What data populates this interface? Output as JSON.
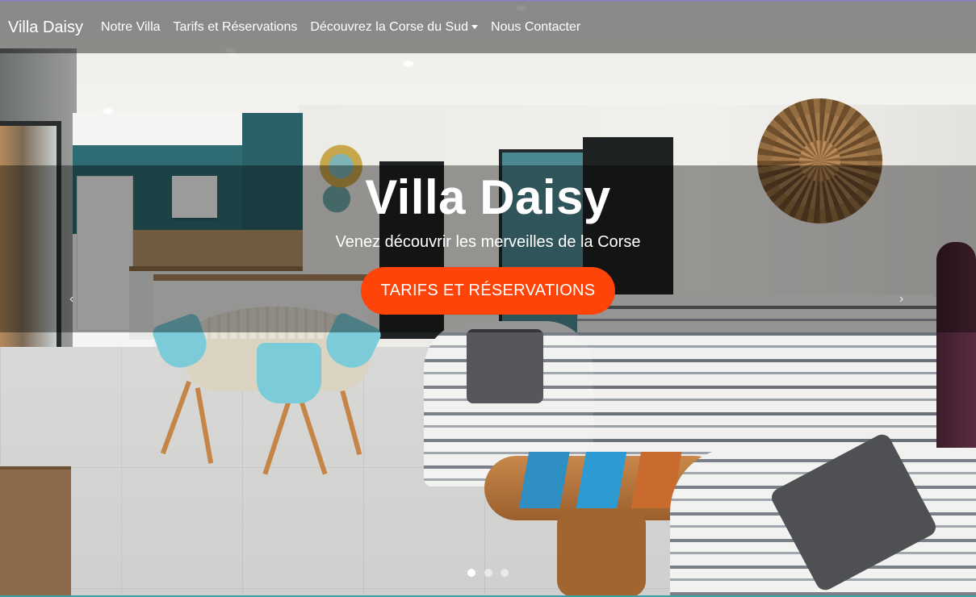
{
  "navbar": {
    "brand": "Villa Daisy",
    "links": [
      "Notre Villa",
      "Tarifs et Réservations",
      "Découvrez la Corse du Sud",
      "Nous Contacter"
    ]
  },
  "hero": {
    "title": "Villa Daisy",
    "subtitle": "Venez découvrir les merveilles de la Corse",
    "cta_label": "TARIFS ET RÉSERVATIONS",
    "prev_icon": "chevron-left-icon",
    "next_icon": "chevron-right-icon",
    "prev_glyph": "‹",
    "next_glyph": "›"
  },
  "carousel": {
    "slide_count": 3,
    "active_index": 0
  },
  "colors": {
    "accent": "#ff4409",
    "overlay": "rgba(0,0,0,0.4)"
  }
}
